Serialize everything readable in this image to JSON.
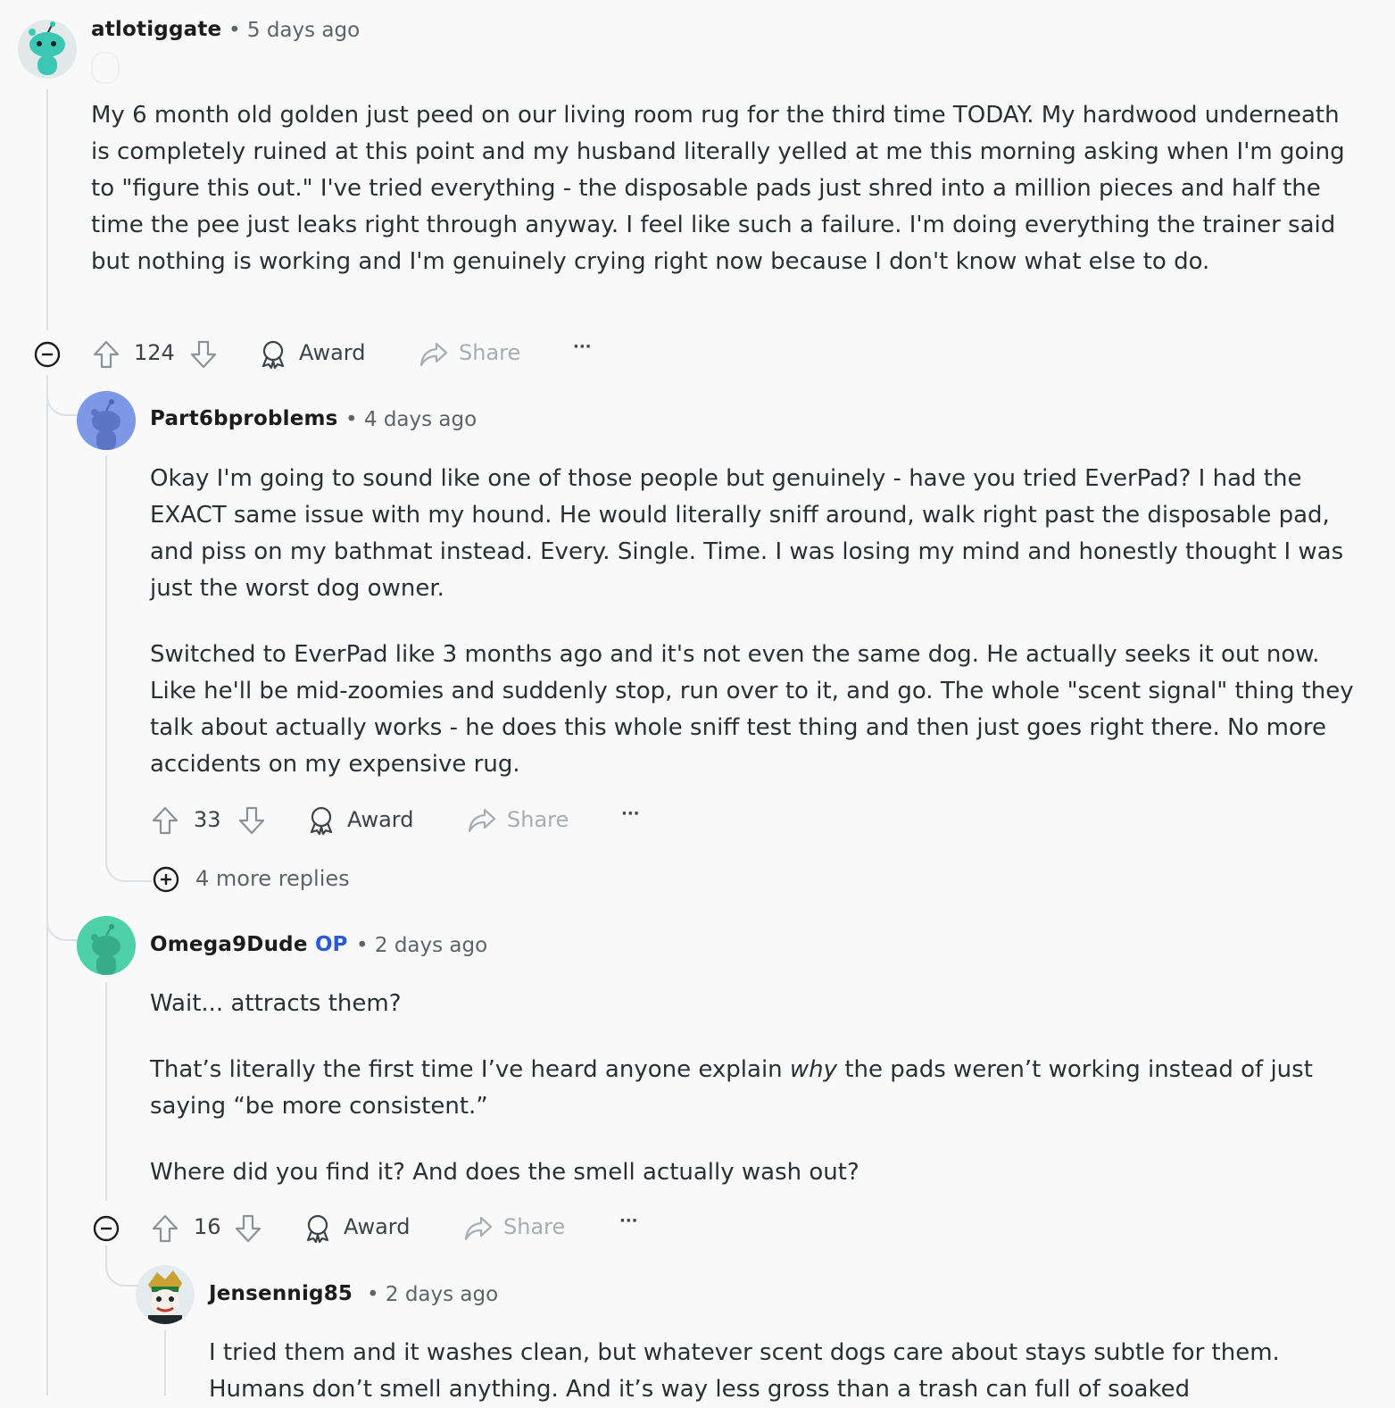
{
  "colors": {
    "accent": "#2a5bd7",
    "thread_line": "#dde0e3",
    "text": "#2a3032",
    "muted": "#5d6466"
  },
  "comments": [
    {
      "author": "atlotiggate",
      "time": "• 5 days ago",
      "body": [
        "My 6 month old golden just peed on our living room rug for the third time TODAY. My hardwood underneath is completely ruined at this point and my husband literally yelled at me this morning asking when I'm going to \"figure this out.\" I've tried everything - the disposable pads just shred into a million pieces and half the time the pee just leaks right through anyway. I feel like such a failure. I'm doing everything the trainer said but nothing is working and I'm genuinely crying right now because I don't know what else to do."
      ],
      "votes": "124",
      "award": "Award",
      "share": "Share",
      "more": "···"
    },
    {
      "author": "Part6bproblems",
      "time": "• 4 days ago",
      "body": [
        "Okay I'm going to sound like one of those people but genuinely - have you tried EverPad? I had the EXACT same issue with my hound. He would literally sniff around, walk right past the disposable pad, and piss on my bathmat instead. Every. Single. Time. I was losing my mind and honestly thought I was just the worst dog owner.",
        "Switched to EverPad like 3 months ago and it's not even the same dog. He actually seeks it out now. Like he'll be mid-zoomies and suddenly stop, run over to it, and go. The whole \"scent signal\" thing they talk about actually works - he does this whole sniff test thing and then just goes right there. No more accidents on my expensive rug."
      ],
      "votes": "33",
      "award": "Award",
      "share": "Share",
      "more": "···",
      "more_replies": "4 more replies"
    },
    {
      "author": "Omega9Dude",
      "op": "OP",
      "time": "• 2 days ago",
      "body_line1": "Wait... attracts them?",
      "body_line2_pre": "That’s literally the first time I’ve heard anyone explain ",
      "body_line2_em": "why",
      "body_line2_post": " the pads weren’t working instead of just saying “be more consistent.”",
      "body_line3": "Where did you find it? And does the smell actually wash out?",
      "votes": "16",
      "award": "Award",
      "share": "Share",
      "more": "···"
    },
    {
      "author": "Jensennig85",
      "time": "• 2 days ago",
      "body": [
        "I tried them and it washes clean, but whatever scent dogs care about stays subtle for them. Humans don’t smell anything. And it’s way less gross than a trash can full of soaked"
      ]
    }
  ]
}
